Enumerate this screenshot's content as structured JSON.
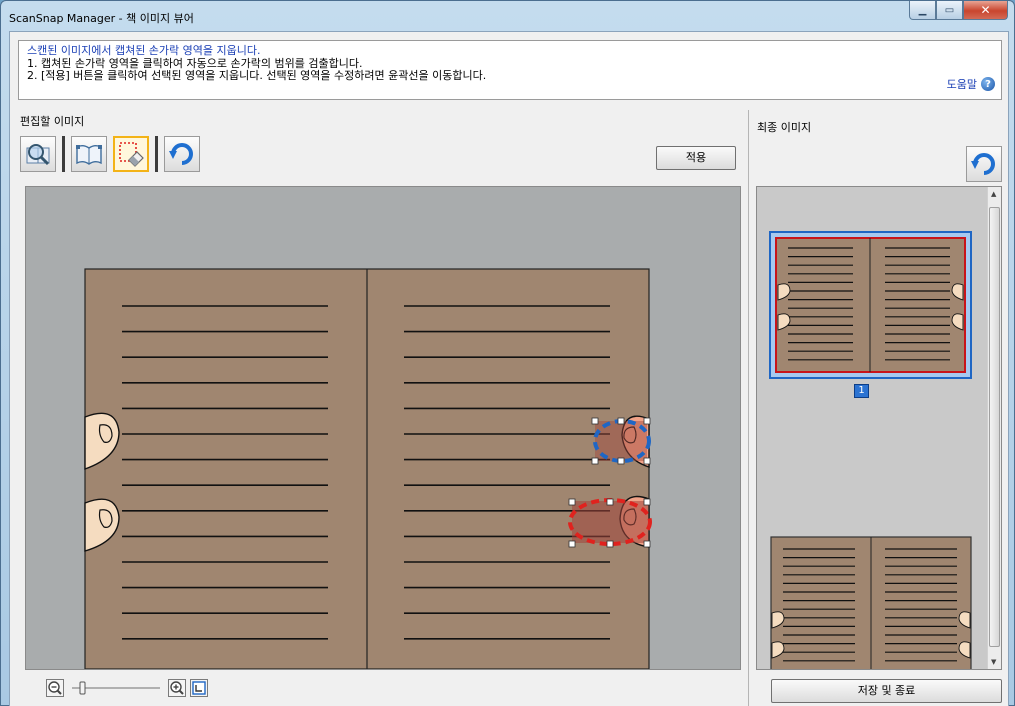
{
  "window": {
    "title": "ScanSnap Manager - 책 이미지 뷰어"
  },
  "instructions": {
    "line1": "스캔된 이미지에서 캡쳐된 손가락 영역을 지웁니다.",
    "line2": "1. 캡쳐된 손가락 영역을 클릭하여 자동으로 손가락의 범위를 검출합니다.",
    "line3": "2. [적용] 버튼을 클릭하여 선택된 영역을 지웁니다. 선택된 영역을 수정하려면 윤곽선을 이동합니다.",
    "help_label": "도움말",
    "help_icon": "question-mark-icon"
  },
  "edit_panel": {
    "label": "편집할 이미지",
    "apply_label": "적용",
    "tools": [
      "magnifier-icon",
      "book-page-icon",
      "finger-eraser-icon",
      "undo-icon"
    ],
    "active_tool": "finger-eraser-icon"
  },
  "final_panel": {
    "label": "최종 이미지",
    "page_number": "1"
  },
  "footer": {
    "save_label": "저장 및 종료"
  },
  "colors": {
    "book": "#a08670",
    "canvas_bg": "#a9acad",
    "selection_blue": "#1f66c4",
    "selection_red": "#e0221e",
    "finger": "#f5dcc0",
    "highlight": "#f3b317"
  }
}
